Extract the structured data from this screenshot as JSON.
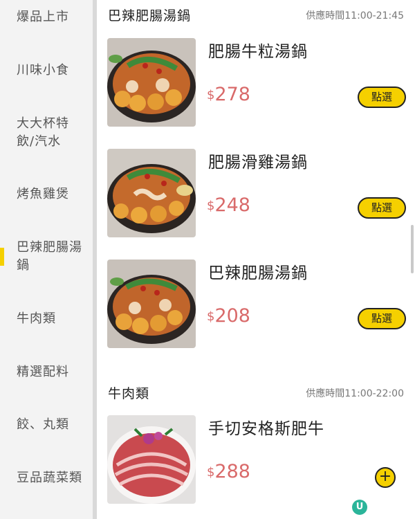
{
  "sidebar": {
    "items": [
      {
        "label": "爆品上市"
      },
      {
        "label": "川味小食"
      },
      {
        "label": "大大杯特飲/汽水"
      },
      {
        "label": "烤魚雞煲"
      },
      {
        "label": "巴辣肥腸湯鍋",
        "active": true
      },
      {
        "label": "牛肉類"
      },
      {
        "label": "精選配料"
      },
      {
        "label": "餃、丸類"
      },
      {
        "label": "豆品蔬菜類"
      }
    ]
  },
  "sections": [
    {
      "title": "巴辣肥腸湯鍋",
      "hours": "供應時間11:00-21:45",
      "products": [
        {
          "name": "肥腸牛粒湯鍋",
          "currency": "$",
          "price": "278",
          "button": "點選"
        },
        {
          "name": "肥腸滑雞湯鍋",
          "currency": "$",
          "price": "248",
          "button": "點選"
        },
        {
          "name": "巴辣肥腸湯鍋",
          "currency": "$",
          "price": "208",
          "button": "點選"
        }
      ]
    },
    {
      "title": "牛肉類",
      "hours": "供應時間11:00-22:00",
      "products": [
        {
          "name": "手切安格斯肥牛",
          "currency": "$",
          "price": "288",
          "button": "+"
        }
      ]
    }
  ],
  "brand_badge": "U",
  "colors": {
    "accent": "#f5d000",
    "price": "#d96a6a",
    "sidebar_bg": "#f3f3f3"
  }
}
